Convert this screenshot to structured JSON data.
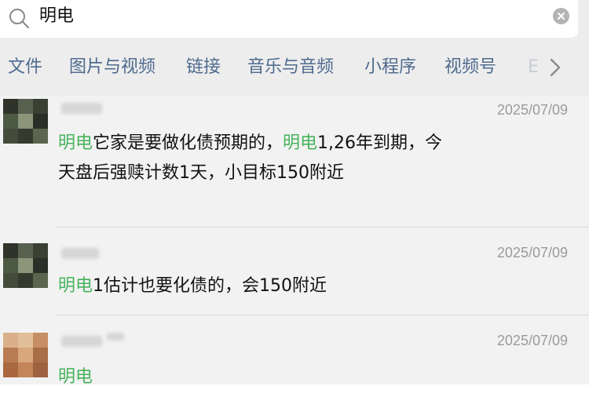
{
  "search": {
    "query": "明电"
  },
  "tabs": [
    "文件",
    "图片与视频",
    "链接",
    "音乐与音频",
    "小程序",
    "视频号",
    "E"
  ],
  "results": [
    {
      "date": "2025/07/09",
      "segments": [
        {
          "text": "明电",
          "highlight": true
        },
        {
          "text": "它家是要做化债预期的，",
          "highlight": false
        },
        {
          "text": "明电",
          "highlight": true
        },
        {
          "text": "1,26年到期，今天盘后强赎计数1天，小目标150附近",
          "highlight": false
        }
      ]
    },
    {
      "date": "2025/07/09",
      "segments": [
        {
          "text": "明电",
          "highlight": true
        },
        {
          "text": "1估计也要化债的，会150附近",
          "highlight": false
        }
      ]
    },
    {
      "date": "2025/07/09",
      "segments": [
        {
          "text": "明电",
          "highlight": true
        }
      ]
    }
  ],
  "colors": {
    "highlight": "#47b35c",
    "tab": "#4f6b8f",
    "date": "#9a9a9a",
    "background": "#ededed"
  },
  "icons": {
    "search": "search-icon",
    "clear": "clear-icon",
    "more": "chevron-right-icon"
  }
}
